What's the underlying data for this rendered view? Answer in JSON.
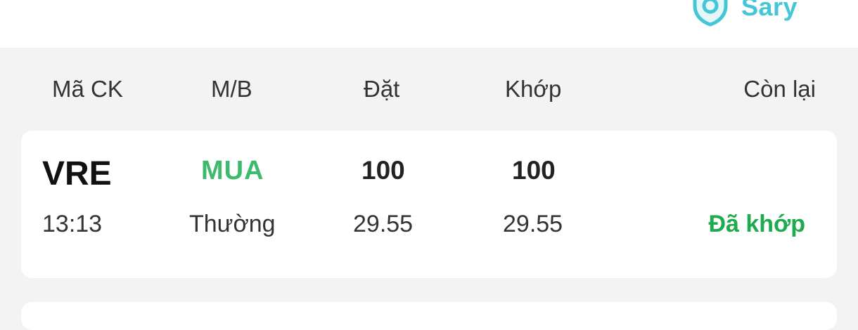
{
  "header": {
    "brand_text": "Sary",
    "brand_color": "#45c6d6"
  },
  "columns": {
    "symbol": "Mã CK",
    "side": "M/B",
    "ordered": "Đặt",
    "matched": "Khớp",
    "remaining": "Còn lại"
  },
  "orders": [
    {
      "symbol": "VRE",
      "side": "MUA",
      "ordered_qty": "100",
      "matched_qty": "100",
      "time": "13:13",
      "order_type": "Thường",
      "ordered_price": "29.55",
      "matched_price": "29.55",
      "status": "Đã khớp"
    }
  ],
  "colors": {
    "buy": "#3dba6b",
    "matched_status": "#1faa4e",
    "background": "#f3f3f3",
    "card": "#ffffff"
  },
  "icons": {
    "brand": "shield-icon"
  }
}
